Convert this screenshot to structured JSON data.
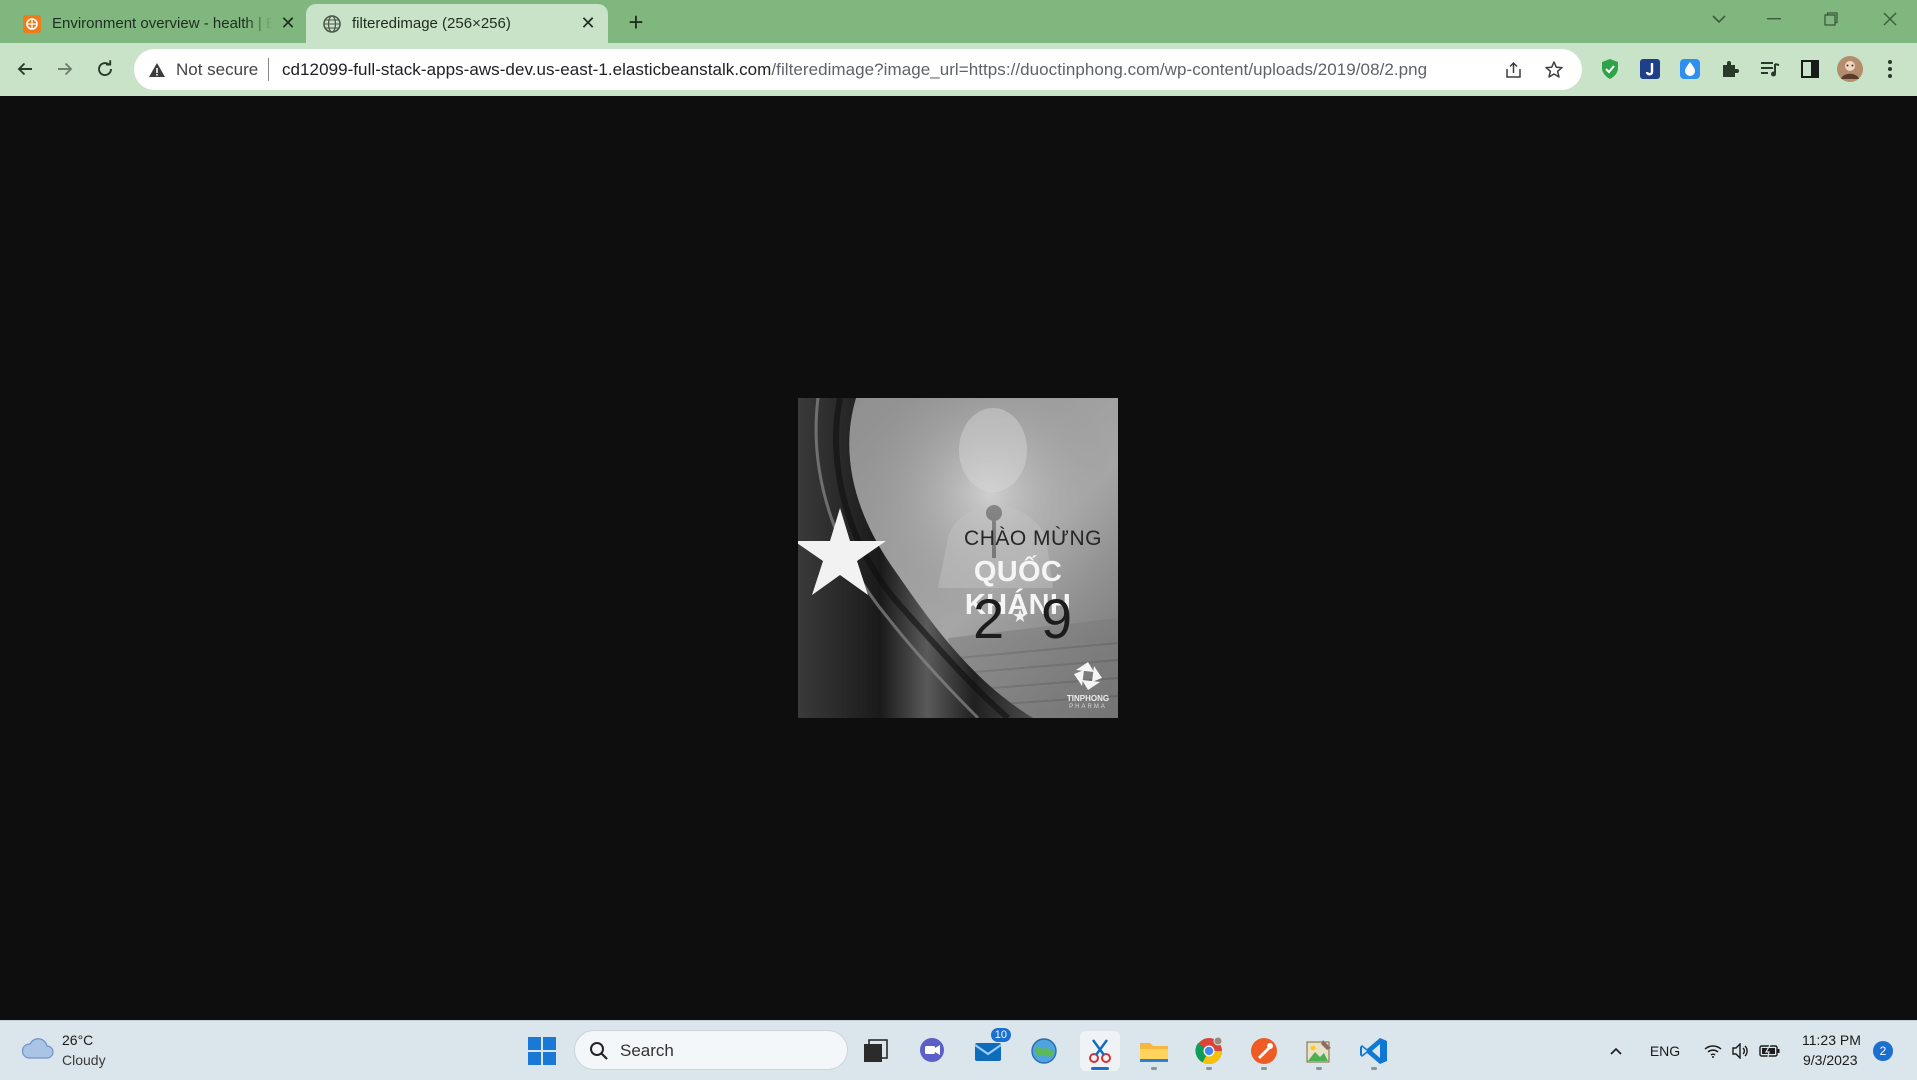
{
  "browser": {
    "tabs": [
      {
        "title": "Environment overview - health | E",
        "icon": "aws-elastic-beanstalk-icon",
        "active": false
      },
      {
        "title": "filteredimage (256×256)",
        "icon": "globe-icon",
        "active": true
      }
    ],
    "new_tab_label": "+",
    "address_bar": {
      "security_label": "Not secure",
      "url_host": "cd12099-full-stack-apps-aws-dev.us-east-1.elasticbeanstalk.com",
      "url_path": "/filteredimage?image_url=https://duoctinphong.com/wp-content/uploads/2019/08/2.png"
    },
    "extensions": [
      "shield-extension-icon",
      "j-extension-icon",
      "droplet-extension-icon",
      "puzzle-extensions-icon",
      "media-queue-icon",
      "side-panel-icon",
      "profile-avatar"
    ]
  },
  "page": {
    "image_natural_size": "256×256",
    "image_filter": "grayscale",
    "image_text": {
      "line1": "CHÀO MỪNG",
      "line2": "QUỐC KHÁNH",
      "line3_left": "2",
      "line3_right": "9",
      "logo_text": "TINPHONG",
      "logo_sub": "PHARMA"
    }
  },
  "taskbar": {
    "weather": {
      "temp": "26°C",
      "desc": "Cloudy"
    },
    "search_label": "Search",
    "apps": [
      {
        "name": "start-icon"
      },
      {
        "name": "task-view-icon"
      },
      {
        "name": "teams-chat-icon"
      },
      {
        "name": "mail-icon",
        "badge": "10"
      },
      {
        "name": "network-globe-icon"
      },
      {
        "name": "snipping-tool-icon",
        "active": true
      },
      {
        "name": "file-explorer-icon"
      },
      {
        "name": "chrome-icon"
      },
      {
        "name": "postman-icon"
      },
      {
        "name": "photo-editor-icon"
      },
      {
        "name": "vscode-icon"
      }
    ],
    "tray": {
      "language": "ENG",
      "time": "11:23 PM",
      "date": "9/3/2023",
      "notifications": "2"
    }
  },
  "colors": {
    "tabstrip": "#7fb77e",
    "toolbar": "#c8e3c7",
    "viewport_bg": "#0e0e0e",
    "taskbar": "#dbe5ec",
    "accent": "#1a6fd0"
  }
}
